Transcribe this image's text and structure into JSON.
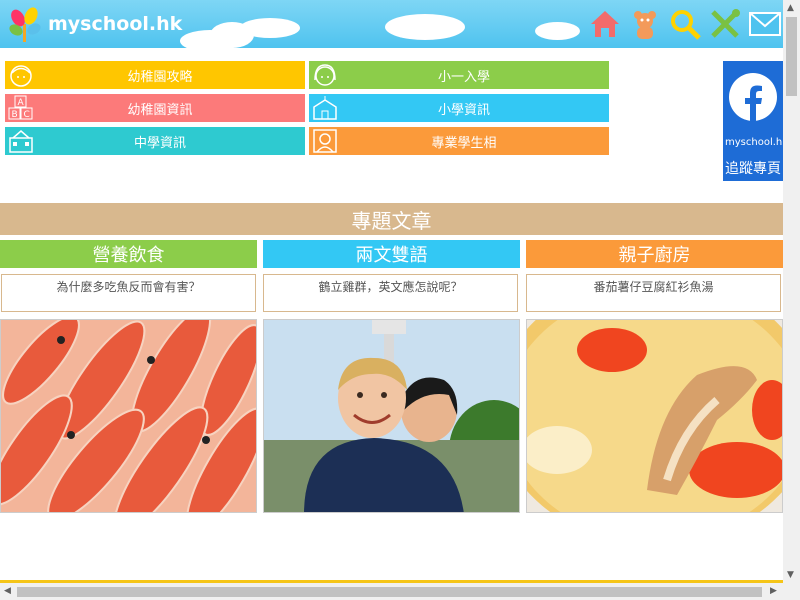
{
  "site": {
    "logo_text": "myschool.hk"
  },
  "header_icons": [
    "home-icon",
    "bear-icon",
    "search-icon",
    "tools-icon",
    "mail-icon"
  ],
  "menu": [
    {
      "label": "幼稚園攻略",
      "color": "#ffc600",
      "icon": "child-face-icon"
    },
    {
      "label": "小一入學",
      "color": "#8ccd4a",
      "icon": "girl-face-icon"
    },
    {
      "label": "幼稚園資訊",
      "color": "#fc7a7a",
      "icon": "abc-blocks-icon"
    },
    {
      "label": "小學資訊",
      "color": "#33c8f4",
      "icon": "school-building-icon"
    },
    {
      "label": "中學資訊",
      "color": "#2ecad0",
      "icon": "high-school-icon"
    },
    {
      "label": "專業學生相",
      "color": "#fb9a3a",
      "icon": "portrait-icon"
    }
  ],
  "facebook": {
    "name": "myschool.hk",
    "follow": "追蹤專頁",
    "color": "#1e6cd6"
  },
  "section": {
    "title": "專題文章"
  },
  "articles": [
    {
      "category": "營養飲食",
      "color": "#8ccd4a",
      "title": "為什麼多吃魚反而會有害？"
    },
    {
      "category": "兩文雙語",
      "color": "#33c8f4",
      "title": "鶴立雞群，英文應怎說呢？"
    },
    {
      "category": "親子廚房",
      "color": "#fb9a3a",
      "title": "番茄薯仔豆腐紅衫魚湯"
    }
  ]
}
